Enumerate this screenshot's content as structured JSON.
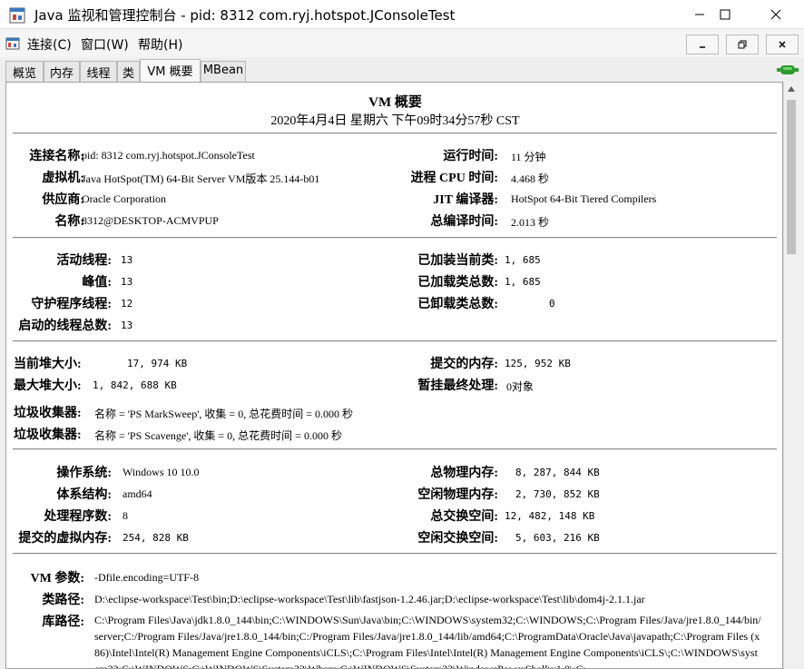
{
  "window": {
    "title": "Java 监视和管理控制台 - pid: 8312 com.ryj.hotspot.JConsoleTest"
  },
  "menu": {
    "items": [
      "连接(C)",
      "窗口(W)",
      "帮助(H)"
    ]
  },
  "tabs": [
    "概览",
    "内存",
    "线程",
    "类",
    "VM 概要",
    "MBean"
  ],
  "active_tab": "VM 概要",
  "summary": {
    "title": "VM 概要",
    "timestamp": "2020年4月4日 星期六 下午09时34分57秒 CST"
  },
  "section1": {
    "left": [
      {
        "label": "连接名称:",
        "value": "pid: 8312 com.ryj.hotspot.JConsoleTest"
      },
      {
        "label": "虚拟机:",
        "value": "Java HotSpot(TM) 64-Bit Server VM版本 25.144-b01"
      },
      {
        "label": "供应商:",
        "value": "Oracle Corporation"
      },
      {
        "label": "名称:",
        "value": "8312@DESKTOP-ACMVPUP"
      }
    ],
    "right": [
      {
        "label": "运行时间:",
        "value": "11 分钟"
      },
      {
        "label": "进程 CPU 时间:",
        "value": "4.468 秒"
      },
      {
        "label": "JIT 编译器:",
        "value": "HotSpot 64-Bit Tiered Compilers"
      },
      {
        "label": "总编译时间:",
        "value": "2.013 秒"
      }
    ]
  },
  "section2": {
    "left": [
      {
        "label": "活动线程:",
        "value": "13"
      },
      {
        "label": "峰值:",
        "value": "13"
      },
      {
        "label": "守护程序线程:",
        "value": "12"
      },
      {
        "label": "启动的线程总数:",
        "value": "13"
      }
    ],
    "right": [
      {
        "label": "已加装当前类:",
        "value": "1, 685"
      },
      {
        "label": "已加载类总数:",
        "value": "1, 685"
      },
      {
        "label": "已卸载类总数:",
        "value": "0"
      }
    ]
  },
  "section3": {
    "left": [
      {
        "label": "当前堆大小:",
        "value": "17, 974 KB"
      },
      {
        "label": "最大堆大小:",
        "value": "1, 842, 688 KB"
      }
    ],
    "right": [
      {
        "label": "提交的内存:",
        "value": "125, 952 KB"
      },
      {
        "label": "暂挂最终处理:",
        "value": "0对象"
      }
    ],
    "gc": [
      {
        "label": "垃圾收集器:",
        "value": "名称 = 'PS MarkSweep', 收集 = 0, 总花费时间 = 0.000 秒"
      },
      {
        "label": "垃圾收集器:",
        "value": "名称 = 'PS Scavenge', 收集 = 0, 总花费时间 = 0.000 秒"
      }
    ]
  },
  "section4": {
    "left": [
      {
        "label": "操作系统:",
        "value": "Windows 10 10.0"
      },
      {
        "label": "体系结构:",
        "value": "amd64"
      },
      {
        "label": "处理程序数:",
        "value": "8"
      },
      {
        "label": "提交的虚拟内存:",
        "value": "254, 828 KB"
      }
    ],
    "right": [
      {
        "label": "总物理内存:",
        "value": "8, 287, 844 KB"
      },
      {
        "label": "空闲物理内存:",
        "value": "2, 730, 852 KB"
      },
      {
        "label": "总交换空间:",
        "value": "12, 482, 148 KB"
      },
      {
        "label": "空闲交换空间:",
        "value": "5, 603, 216 KB"
      }
    ]
  },
  "section5": {
    "vm_args": {
      "label": "VM 参数:",
      "value": "-Dfile.encoding=UTF-8"
    },
    "class_path": {
      "label": "类路径:",
      "value": "D:\\eclipse-workspace\\Test\\bin;D:\\eclipse-workspace\\Test\\lib\\fastjson-1.2.46.jar;D:\\eclipse-workspace\\Test\\lib\\dom4j-2.1.1.jar"
    },
    "library_path": {
      "label": "库路径:",
      "value": "C:\\Program Files\\Java\\jdk1.8.0_144\\bin;C:\\WINDOWS\\Sun\\Java\\bin;C:\\WINDOWS\\system32;C:\\WINDOWS;C:\\Program Files/Java/jre1.8.0_144/bin/server;C:/Program Files/Java/jre1.8.0_144/bin;C:/Program Files/Java/jre1.8.0_144/lib/amd64;C:\\ProgramData\\Oracle\\Java\\javapath;C:\\Program Files (x86)\\Intel\\Intel(R) Management Engine Components\\iCLS\\;C:\\Program Files\\Intel\\Intel(R) Management Engine Components\\iCLS\\;C:\\WINDOWS\\system32;C:\\WINDOWS;C:\\WINDOWS\\System32\\Wbem;C:\\WINDOWS\\System32\\WindowsPowerShell\\v1.0\\;C:"
    }
  },
  "icons": {
    "app": "java-cup-icon",
    "connection": "connection-plug-icon"
  },
  "colors": {
    "connected": "#2e9b2e",
    "window_bg": "#ffffff",
    "panel_bg": "#ffffff"
  }
}
